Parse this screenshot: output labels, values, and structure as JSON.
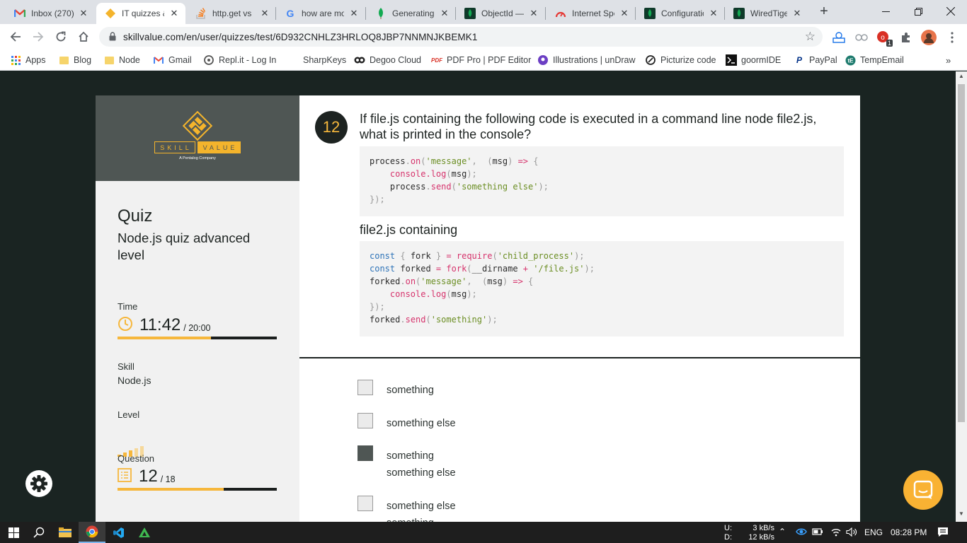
{
  "browser": {
    "tabs": [
      {
        "label": "Inbox (270) &",
        "favicon": "gmail-icon"
      },
      {
        "label": "IT quizzes &",
        "favicon": "skillvalue-icon"
      },
      {
        "label": "http.get vs",
        "favicon": "stackoverflow-icon"
      },
      {
        "label": "how are mo",
        "favicon": "google-icon"
      },
      {
        "label": "Generating",
        "favicon": "mongodb-icon"
      },
      {
        "label": "ObjectId —",
        "favicon": "mongodb-docs-icon"
      },
      {
        "label": "Internet Spe",
        "favicon": "speedtest-icon"
      },
      {
        "label": "Configuratio",
        "favicon": "mongodb-docs-icon"
      },
      {
        "label": "WiredTiger",
        "favicon": "mongodb-docs-icon"
      }
    ],
    "active_tab_index": 1,
    "url": "skillvalue.com/en/user/quizzes/test/6D932CNHLZ3HRLOQ8JBP7NNMNJKBEMK1",
    "extension_badge": "1",
    "bookmarks": [
      {
        "label": "Apps",
        "icon": "apps-grid-icon"
      },
      {
        "label": "Blog",
        "icon": "folder-icon"
      },
      {
        "label": "Node",
        "icon": "folder-icon"
      },
      {
        "label": "Gmail",
        "icon": "gmail-icon"
      },
      {
        "label": "Repl.it - Log In",
        "icon": "replit-icon"
      },
      {
        "label": "SharpKeys",
        "icon": "blank-icon"
      },
      {
        "label": "Degoo Cloud",
        "icon": "degoo-icon"
      },
      {
        "label": "PDF Pro | PDF Editor",
        "icon": "pdf-icon"
      },
      {
        "label": "Illustrations | unDraw",
        "icon": "undraw-icon"
      },
      {
        "label": "Picturize code",
        "icon": "picturize-icon"
      },
      {
        "label": "goormIDE",
        "icon": "terminal-icon"
      },
      {
        "label": "PayPal",
        "icon": "paypal-icon"
      },
      {
        "label": "TempEmail",
        "icon": "tempemail-icon"
      }
    ]
  },
  "sidebar": {
    "logo": {
      "skill": "SKILL",
      "value": "VALUE",
      "tagline": "A Pentalog Company"
    },
    "title": "Quiz",
    "quiz_name": "Node.js quiz advanced level",
    "time_label": "Time",
    "time_value": "11:42",
    "time_total": "/ 20:00",
    "time_progress": 0.585,
    "skill_label": "Skill",
    "skill_value": "Node.js",
    "level_label": "Level",
    "level_filled": 3,
    "level_total": 5,
    "question_label": "Question",
    "question_value": "12",
    "question_total": "/ 18",
    "question_progress": 0.667
  },
  "question": {
    "number": "12",
    "text": "If file.js containing the following code is executed in a command line node file2.js, what is printed in the console?",
    "code1": [
      [
        [
          "plain",
          "process"
        ],
        [
          "pn",
          "."
        ],
        [
          "fn",
          "on"
        ],
        [
          "pn",
          "("
        ],
        [
          "st",
          "'message'"
        ],
        [
          "pn",
          ",  ("
        ],
        [
          "plain",
          "msg"
        ],
        [
          "pn",
          ") "
        ],
        [
          "fn",
          "=>"
        ],
        [
          "pn",
          " {"
        ]
      ],
      [
        [
          "plain",
          "    "
        ],
        [
          "fn",
          "console.log"
        ],
        [
          "pn",
          "("
        ],
        [
          "plain",
          "msg"
        ],
        [
          "pn",
          ");"
        ]
      ],
      [
        [
          "plain",
          "    process"
        ],
        [
          "pn",
          "."
        ],
        [
          "fn",
          "send"
        ],
        [
          "pn",
          "("
        ],
        [
          "st",
          "'something else'"
        ],
        [
          "pn",
          ");"
        ]
      ],
      [
        [
          "pn",
          "});"
        ]
      ]
    ],
    "subtitle": "file2.js containing",
    "code2": [
      [
        [
          "kw",
          "const"
        ],
        [
          "pn",
          " { "
        ],
        [
          "plain",
          "fork"
        ],
        [
          "pn",
          " } "
        ],
        [
          "fn",
          "="
        ],
        [
          "plain",
          " "
        ],
        [
          "fn",
          "require"
        ],
        [
          "pn",
          "("
        ],
        [
          "st",
          "'child_process'"
        ],
        [
          "pn",
          ");"
        ]
      ],
      [
        [
          "kw",
          "const"
        ],
        [
          "plain",
          " forked "
        ],
        [
          "fn",
          "="
        ],
        [
          "plain",
          " "
        ],
        [
          "fn",
          "fork"
        ],
        [
          "pn",
          "("
        ],
        [
          "plain",
          "__dirname "
        ],
        [
          "fn",
          "+"
        ],
        [
          "plain",
          " "
        ],
        [
          "st",
          "'/file.js'"
        ],
        [
          "pn",
          ");"
        ]
      ],
      [
        [
          "plain",
          "forked"
        ],
        [
          "pn",
          "."
        ],
        [
          "fn",
          "on"
        ],
        [
          "pn",
          "("
        ],
        [
          "st",
          "'message'"
        ],
        [
          "pn",
          ",  ("
        ],
        [
          "plain",
          "msg"
        ],
        [
          "pn",
          ") "
        ],
        [
          "fn",
          "=>"
        ],
        [
          "pn",
          " {"
        ]
      ],
      [
        [
          "plain",
          "    "
        ],
        [
          "fn",
          "console.log"
        ],
        [
          "pn",
          "("
        ],
        [
          "plain",
          "msg"
        ],
        [
          "pn",
          ");"
        ]
      ],
      [
        [
          "pn",
          "});"
        ]
      ],
      [
        [
          "plain",
          "forked"
        ],
        [
          "pn",
          "."
        ],
        [
          "fn",
          "send"
        ],
        [
          "pn",
          "("
        ],
        [
          "st",
          "'something'"
        ],
        [
          "pn",
          ");"
        ]
      ]
    ],
    "options": [
      {
        "lines": [
          "something"
        ],
        "checked": false
      },
      {
        "lines": [
          "something else"
        ],
        "checked": false
      },
      {
        "lines": [
          "something",
          "something else"
        ],
        "checked": true
      },
      {
        "lines": [
          "something else",
          "something"
        ],
        "checked": false
      }
    ]
  },
  "taskbar": {
    "net_up_label": "U:",
    "net_up": "3 kB/s",
    "net_down_label": "D:",
    "net_down": "12 kB/s",
    "language": "ENG",
    "clock": "08:28 PM"
  },
  "colors": {
    "accent": "#f6b73c",
    "dark": "#1d2321",
    "logo_band": "#4f5654",
    "page_bg": "#1a2422"
  }
}
